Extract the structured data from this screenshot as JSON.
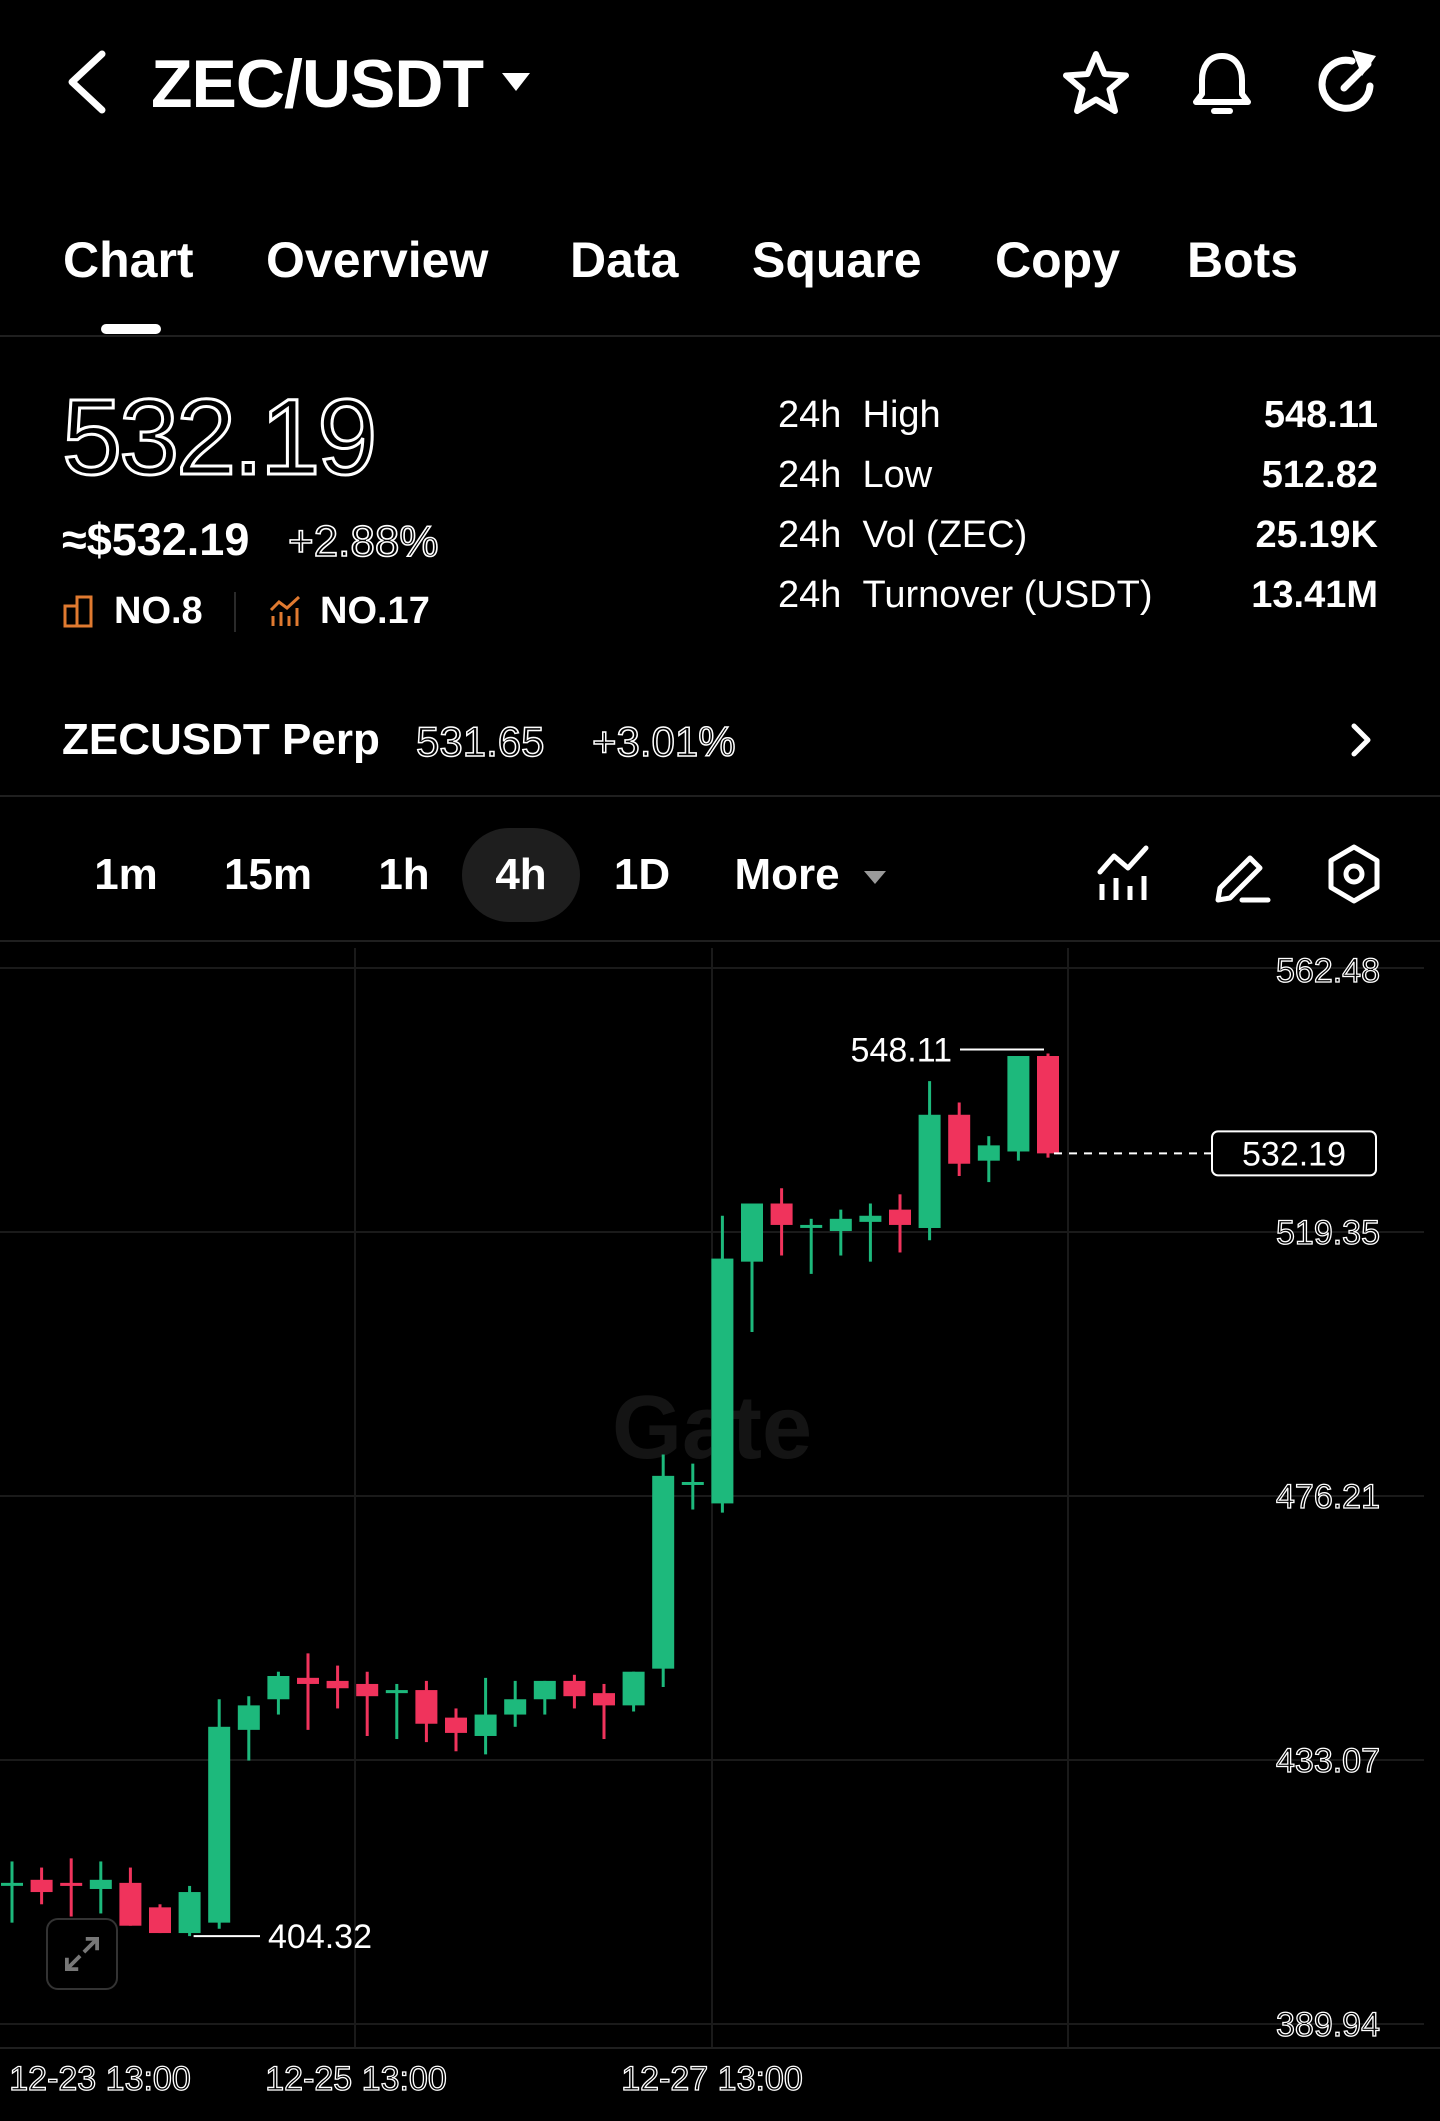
{
  "header": {
    "pair": "ZEC/USDT",
    "icons": [
      "back-icon",
      "chevron-down-icon",
      "star-icon",
      "bell-icon",
      "share-icon"
    ]
  },
  "tabs": [
    "Chart",
    "Overview",
    "Data",
    "Square",
    "Copy",
    "Bots"
  ],
  "active_tab": "Chart",
  "price": {
    "last": "532.19",
    "usd": "≈$532.19",
    "change": "+2.88%",
    "rank_market_cap": "NO.8",
    "rank_trend": "NO.17"
  },
  "stats": [
    {
      "period": "24h",
      "label": "High",
      "value": "548.11"
    },
    {
      "period": "24h",
      "label": "Low",
      "value": "512.82"
    },
    {
      "period": "24h",
      "label": "Vol (ZEC)",
      "value": "25.19K"
    },
    {
      "period": "24h",
      "label": "Turnover (USDT)",
      "value": "13.41M"
    }
  ],
  "perp": {
    "name": "ZECUSDT Perp",
    "price": "531.65",
    "change": "+3.01%"
  },
  "intervals": [
    "1m",
    "15m",
    "1h",
    "4h",
    "1D",
    "More"
  ],
  "active_interval": "4h",
  "colors": {
    "background": "#000000",
    "up": "#1db97c",
    "down": "#f0335c",
    "grid": "#1a1a1a",
    "accent_rank": "#e07a30"
  },
  "chart_data": {
    "type": "candlestick",
    "watermark": "Gate",
    "y_ticks": [
      "562.48",
      "519.35",
      "476.21",
      "433.07",
      "389.94"
    ],
    "ylim": [
      389.94,
      562.48
    ],
    "x_ticks": [
      "12-23 13:00",
      "12-25 13:00",
      "12-27 13:00"
    ],
    "high_label": "548.11",
    "low_label": "404.32",
    "last_price_label": "532.19",
    "last_price": 532.19,
    "candles": [
      {
        "o": 413.0,
        "h": 416.5,
        "l": 406.5,
        "c": 413.0
      },
      {
        "o": 413.5,
        "h": 415.5,
        "l": 409.5,
        "c": 411.5
      },
      {
        "o": 413.0,
        "h": 417.0,
        "l": 407.5,
        "c": 412.5
      },
      {
        "o": 412.0,
        "h": 416.5,
        "l": 408.0,
        "c": 413.5
      },
      {
        "o": 413.0,
        "h": 415.5,
        "l": 406.0,
        "c": 406.0
      },
      {
        "o": 409.0,
        "h": 409.5,
        "l": 404.8,
        "c": 404.8
      },
      {
        "o": 404.8,
        "h": 412.5,
        "l": 404.3,
        "c": 411.5
      },
      {
        "o": 406.5,
        "h": 443.0,
        "l": 405.5,
        "c": 438.5
      },
      {
        "o": 438.0,
        "h": 443.5,
        "l": 433.0,
        "c": 442.0
      },
      {
        "o": 443.0,
        "h": 447.5,
        "l": 440.5,
        "c": 446.8
      },
      {
        "o": 446.5,
        "h": 450.5,
        "l": 438.0,
        "c": 445.5
      },
      {
        "o": 446.0,
        "h": 448.5,
        "l": 441.5,
        "c": 444.8
      },
      {
        "o": 445.5,
        "h": 447.5,
        "l": 437.0,
        "c": 443.5
      },
      {
        "o": 444.0,
        "h": 445.5,
        "l": 436.5,
        "c": 444.5
      },
      {
        "o": 444.5,
        "h": 446.0,
        "l": 436.0,
        "c": 439.0
      },
      {
        "o": 440.0,
        "h": 441.5,
        "l": 434.5,
        "c": 437.5
      },
      {
        "o": 437.0,
        "h": 446.5,
        "l": 434.0,
        "c": 440.5
      },
      {
        "o": 440.5,
        "h": 446.0,
        "l": 438.5,
        "c": 443.0
      },
      {
        "o": 443.0,
        "h": 446.0,
        "l": 440.5,
        "c": 446.0
      },
      {
        "o": 446.0,
        "h": 447.0,
        "l": 441.5,
        "c": 443.5
      },
      {
        "o": 444.0,
        "h": 445.5,
        "l": 436.5,
        "c": 442.0
      },
      {
        "o": 442.0,
        "h": 447.5,
        "l": 441.0,
        "c": 447.5
      },
      {
        "o": 448.0,
        "h": 483.0,
        "l": 445.0,
        "c": 479.5
      },
      {
        "o": 478.5,
        "h": 481.5,
        "l": 474.0,
        "c": 478.5
      },
      {
        "o": 475.0,
        "h": 522.0,
        "l": 473.5,
        "c": 515.0
      },
      {
        "o": 514.5,
        "h": 523.5,
        "l": 503.0,
        "c": 524.0
      },
      {
        "o": 524.0,
        "h": 526.5,
        "l": 515.5,
        "c": 520.5
      },
      {
        "o": 520.5,
        "h": 521.5,
        "l": 512.5,
        "c": 520.5
      },
      {
        "o": 519.5,
        "h": 523.0,
        "l": 515.5,
        "c": 521.5
      },
      {
        "o": 521.0,
        "h": 524.0,
        "l": 514.5,
        "c": 522.0
      },
      {
        "o": 523.0,
        "h": 525.5,
        "l": 516.0,
        "c": 520.5
      },
      {
        "o": 520.0,
        "h": 544.0,
        "l": 518.0,
        "c": 538.5
      },
      {
        "o": 538.5,
        "h": 540.5,
        "l": 528.5,
        "c": 530.5
      },
      {
        "o": 531.0,
        "h": 535.0,
        "l": 527.5,
        "c": 533.5
      },
      {
        "o": 532.5,
        "h": 548.1,
        "l": 531.0,
        "c": 548.1
      },
      {
        "o": 548.1,
        "h": 548.5,
        "l": 531.5,
        "c": 532.19
      }
    ]
  }
}
